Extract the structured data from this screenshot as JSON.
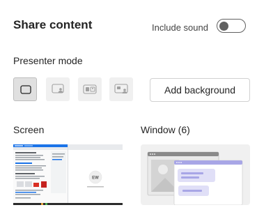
{
  "header": {
    "title": "Share content",
    "include_sound_label": "Include sound",
    "include_sound_on": false
  },
  "presenter": {
    "label": "Presenter mode",
    "modes": [
      {
        "name": "content-only",
        "selected": true
      },
      {
        "name": "standout",
        "selected": false
      },
      {
        "name": "side-by-side",
        "selected": false
      },
      {
        "name": "reporter",
        "selected": false
      }
    ],
    "add_background_label": "Add background"
  },
  "sources": {
    "screen_label": "Screen",
    "window_label": "Window (6)",
    "screen_avatar_initials": "EW"
  },
  "colors": {
    "window_accent": "#a8a6e6",
    "window_accent_dark": "#8f8ce0",
    "toggle_off": "#616161"
  }
}
